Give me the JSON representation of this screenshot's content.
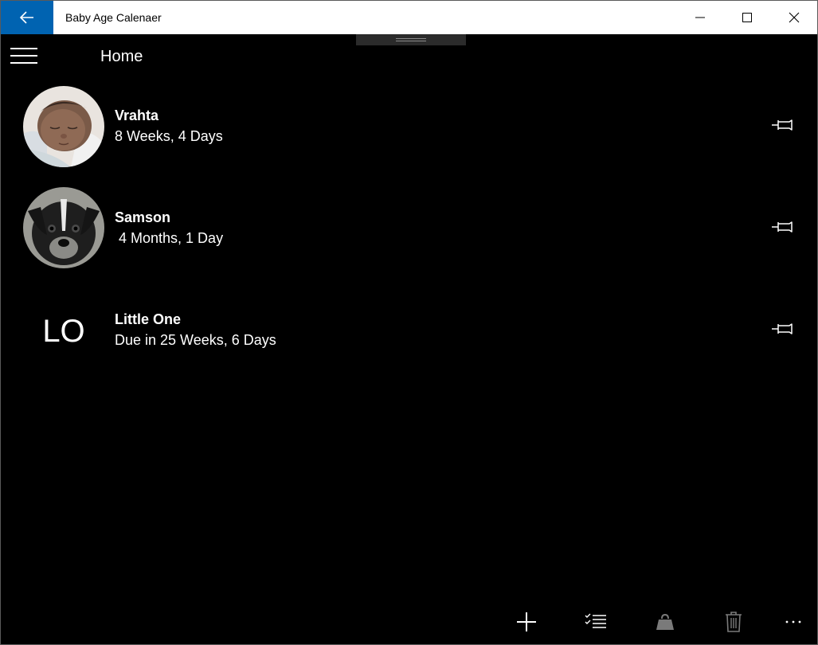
{
  "window": {
    "title": "Baby Age Calenaer"
  },
  "header": {
    "title": "Home"
  },
  "entries": [
    {
      "name": "Vrahta",
      "age": "8 Weeks, 4 Days",
      "avatar": "baby-photo"
    },
    {
      "name": "Samson",
      "age": " 4 Months, 1 Day",
      "avatar": "puppy-photo"
    },
    {
      "name": "Little One",
      "age": "Due in 25 Weeks, 6 Days",
      "initials": "LO"
    }
  ],
  "command_bar": {
    "buttons": [
      "add-icon",
      "multi-select-icon",
      "weight-icon",
      "delete-icon",
      "more-icon"
    ]
  },
  "colors": {
    "accent": "#0063b1",
    "background": "#000000"
  }
}
